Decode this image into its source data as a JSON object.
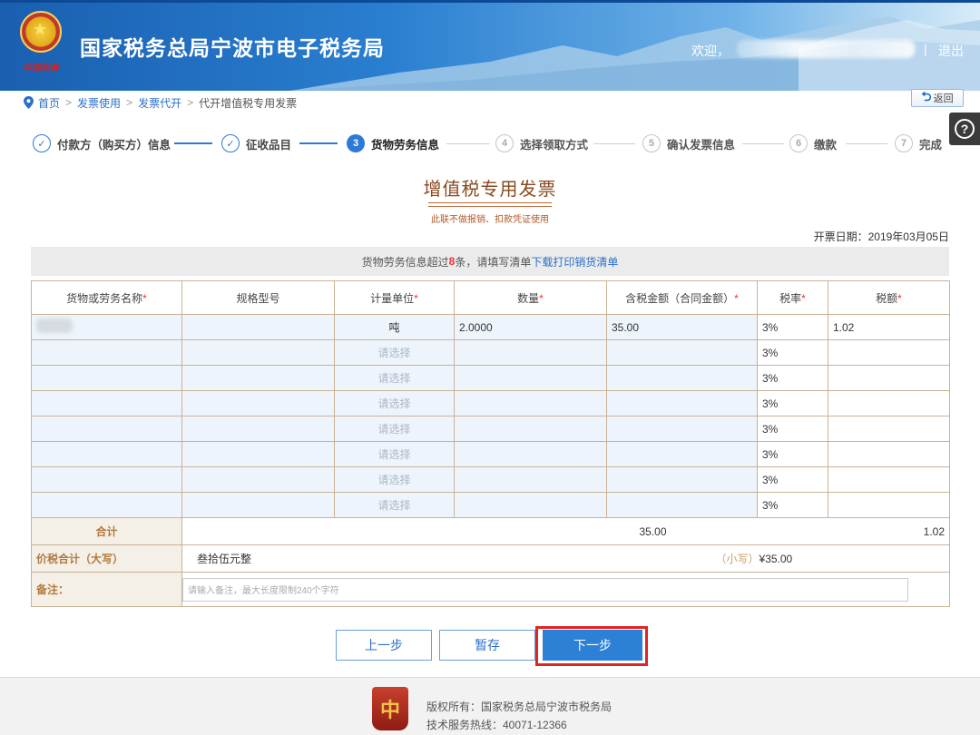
{
  "header": {
    "title": "国家税务总局宁波市电子税务局",
    "emblem_caption": "中国税务",
    "welcome": "欢迎，",
    "separator": "|",
    "logout": "退出"
  },
  "breadcrumb": {
    "items": [
      "首页",
      "发票使用",
      "发票代开"
    ],
    "current": "代开增值税专用发票",
    "separator": ">",
    "back_label": "返回"
  },
  "steps": [
    {
      "num": "✓",
      "label": "付款方（购买方）信息",
      "state": "done"
    },
    {
      "num": "✓",
      "label": "征收品目",
      "state": "done"
    },
    {
      "num": "3",
      "label": "货物劳务信息",
      "state": "active"
    },
    {
      "num": "4",
      "label": "选择领取方式",
      "state": "todo"
    },
    {
      "num": "5",
      "label": "确认发票信息",
      "state": "todo"
    },
    {
      "num": "6",
      "label": "缴款",
      "state": "todo"
    },
    {
      "num": "7",
      "label": "完成",
      "state": "todo"
    }
  ],
  "invoice": {
    "title": "增值税专用发票",
    "subtitle": "此联不做报销、扣款凭证使用",
    "date": "开票日期：2019年03月05日"
  },
  "notice": {
    "prefix": "货物劳务信息超过",
    "count": "8",
    "middle": "条，请填写清单",
    "link": "下载打印销货清单"
  },
  "table": {
    "headers": [
      {
        "label": "货物或劳务名称",
        "required": true
      },
      {
        "label": "规格型号",
        "required": false
      },
      {
        "label": "计量单位",
        "required": true
      },
      {
        "label": "数量",
        "required": true
      },
      {
        "label": "含税金额（合同金额）",
        "required": true
      },
      {
        "label": "税率",
        "required": true
      },
      {
        "label": "税额",
        "required": true
      }
    ],
    "required_mark": "*",
    "rows": [
      {
        "name": "",
        "spec": "",
        "unit": "吨",
        "qty": "2.0000",
        "amount": "35.00",
        "rate": "3%",
        "tax": "1.02"
      },
      {
        "name": "",
        "spec": "",
        "unit": "请选择",
        "qty": "",
        "amount": "",
        "rate": "3%",
        "tax": ""
      },
      {
        "name": "",
        "spec": "",
        "unit": "请选择",
        "qty": "",
        "amount": "",
        "rate": "3%",
        "tax": ""
      },
      {
        "name": "",
        "spec": "",
        "unit": "请选择",
        "qty": "",
        "amount": "",
        "rate": "3%",
        "tax": ""
      },
      {
        "name": "",
        "spec": "",
        "unit": "请选择",
        "qty": "",
        "amount": "",
        "rate": "3%",
        "tax": ""
      },
      {
        "name": "",
        "spec": "",
        "unit": "请选择",
        "qty": "",
        "amount": "",
        "rate": "3%",
        "tax": ""
      },
      {
        "name": "",
        "spec": "",
        "unit": "请选择",
        "qty": "",
        "amount": "",
        "rate": "3%",
        "tax": ""
      },
      {
        "name": "",
        "spec": "",
        "unit": "请选择",
        "qty": "",
        "amount": "",
        "rate": "3%",
        "tax": ""
      }
    ],
    "total_label": "合计",
    "total_amount": "35.00",
    "total_tax": "1.02",
    "price_total_label": "价税合计（大写）",
    "price_total_upper": "叁拾伍元整",
    "price_total_lower_label": "（小写）",
    "price_total_lower": "¥35.00",
    "note_label": "备注：",
    "note_placeholder": "请输入备注，最大长度限制240个字符"
  },
  "buttons": {
    "prev": "上一步",
    "save": "暂存",
    "next": "下一步"
  },
  "footer": {
    "copyright": "版权所有：国家税务总局宁波市税务局",
    "hotline": "技术服务热线：40071-12366",
    "logo_char": "中"
  },
  "colors": {
    "header_blue": "#1a5fb0",
    "accent_blue": "#2c7ad6",
    "invoice_brown": "#8a4a22",
    "required_red": "#ee3333",
    "highlight_red": "#e02424"
  }
}
